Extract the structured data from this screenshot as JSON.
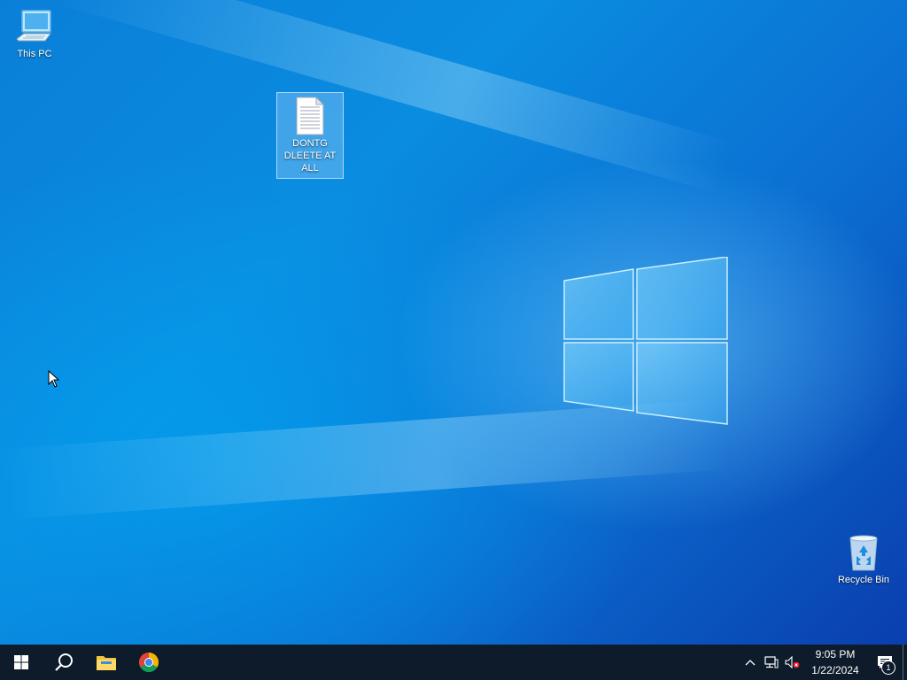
{
  "desktop": {
    "icons": [
      {
        "label": "This PC"
      },
      {
        "label": "DONTG DLEETE AT ALL"
      },
      {
        "label": "Recycle Bin"
      }
    ]
  },
  "taskbar": {
    "start_icon": "windows-start-icon",
    "search_icon": "search-icon",
    "pinned": [
      "file-explorer-icon",
      "chrome-icon"
    ],
    "tray": {
      "overflow_icon": "chevron-up-icon",
      "network_icon": "network-icon",
      "volume_icon": "volume-muted-icon",
      "time": "9:05 PM",
      "date": "1/22/2024",
      "notification_count": "1"
    }
  },
  "colors": {
    "taskbar_bg": "#0d1b2a",
    "desktop_accent": "#0a7fd8",
    "selection": "#aad7ff"
  }
}
